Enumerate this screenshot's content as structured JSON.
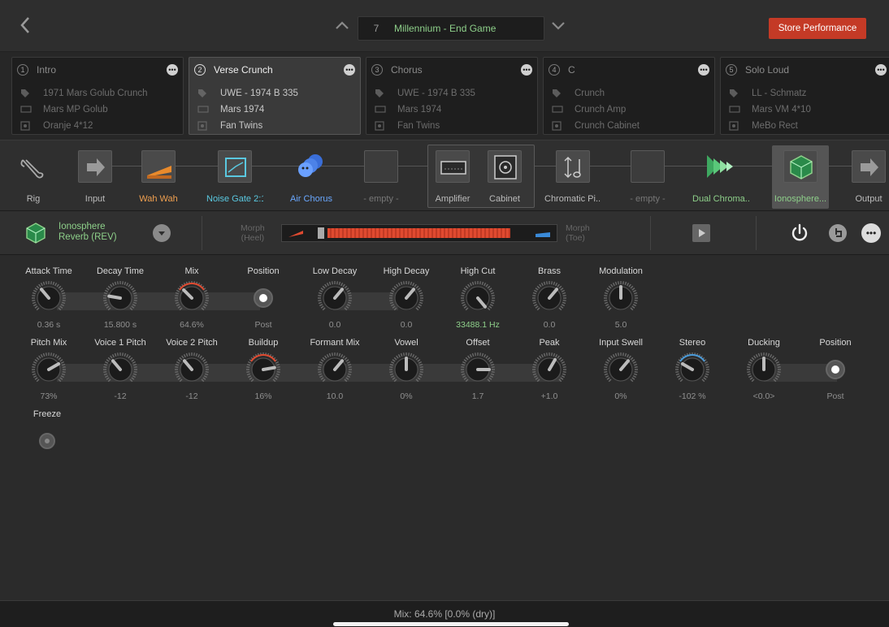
{
  "topbar": {
    "perf_number": "7",
    "perf_name": "Millennium - End Game",
    "store_label": "Store Performance"
  },
  "scenes": [
    {
      "num": "1",
      "name": "Intro",
      "pedal": "1971 Mars Golub Crunch",
      "amp": "Mars MP Golub",
      "cab": "Oranje 4*12",
      "active": false
    },
    {
      "num": "2",
      "name": "Verse Crunch",
      "pedal": "UWE - 1974 B 335",
      "amp": "Mars 1974",
      "cab": "Fan Twins",
      "active": true
    },
    {
      "num": "3",
      "name": "Chorus",
      "pedal": "UWE - 1974 B 335",
      "amp": "Mars 1974",
      "cab": "Fan Twins",
      "active": false
    },
    {
      "num": "4",
      "name": "C",
      "pedal": "Crunch",
      "amp": "Crunch Amp",
      "cab": "Crunch Cabinet",
      "active": false
    },
    {
      "num": "5",
      "name": "Solo Loud",
      "pedal": "LL - Schmatz",
      "amp": "Mars VM 4*10",
      "cab": "MeBo Rect",
      "active": false
    }
  ],
  "chain": [
    {
      "label": "Rig",
      "icon": "rig-icon"
    },
    {
      "label": "Input",
      "icon": "input-arrow-icon"
    },
    {
      "label": "Wah Wah",
      "icon": "wah-pedal-icon"
    },
    {
      "label": "Noise Gate 2:1",
      "icon": "noise-gate-icon"
    },
    {
      "label": "Air Chorus",
      "icon": "chorus-icon"
    },
    {
      "label": "- empty -",
      "icon": "empty-slot-icon"
    },
    {
      "label": "Amplifier",
      "icon": "amplifier-icon"
    },
    {
      "label": "Cabinet",
      "icon": "cabinet-icon"
    },
    {
      "label": "Chromatic Pi...",
      "icon": "pitch-icon"
    },
    {
      "label": "- empty -",
      "icon": "empty-slot-icon"
    },
    {
      "label": "Dual Chroma...",
      "icon": "dual-chromatic-icon"
    },
    {
      "label": "Ionosphere...",
      "icon": "ionosphere-icon"
    },
    {
      "label": "Output",
      "icon": "output-arrow-icon"
    }
  ],
  "plugin": {
    "name_line1": "Ionosphere",
    "name_line2": "Reverb (REV)",
    "morph_heel_line1": "Morph",
    "morph_heel_line2": "(Heel)",
    "morph_toe_line1": "Morph",
    "morph_toe_line2": "(Toe)",
    "morph_level": 0.75
  },
  "params_row1": [
    {
      "label": "Attack Time",
      "value": "0.36 s"
    },
    {
      "label": "Decay Time",
      "value": "15.800 s"
    },
    {
      "label": "Mix",
      "value": "64.6%"
    },
    {
      "label": "Position",
      "value": "Post"
    },
    {
      "label": "Low Decay",
      "value": "0.0"
    },
    {
      "label": "High Decay",
      "value": "0.0"
    },
    {
      "label": "High Cut",
      "value": "33488.1 Hz"
    },
    {
      "label": "Brass",
      "value": "0.0"
    },
    {
      "label": "Modulation",
      "value": "5.0"
    }
  ],
  "params_row2": [
    {
      "label": "Pitch Mix",
      "value": "73%"
    },
    {
      "label": "Voice 1 Pitch",
      "value": "-12"
    },
    {
      "label": "Voice 2 Pitch",
      "value": "-12"
    },
    {
      "label": "Buildup",
      "value": "16%"
    },
    {
      "label": "Formant Mix",
      "value": "10.0"
    },
    {
      "label": "Vowel",
      "value": "0%"
    },
    {
      "label": "Offset",
      "value": "1.7"
    },
    {
      "label": "Peak",
      "value": "+1.0"
    },
    {
      "label": "Input Swell",
      "value": "0%"
    },
    {
      "label": "Stereo",
      "value": "-102 %"
    },
    {
      "label": "Ducking",
      "value": "<0.0>"
    },
    {
      "label": "Position",
      "value": "Post"
    }
  ],
  "params_row3": [
    {
      "label": "Freeze"
    }
  ],
  "status": {
    "text": "Mix: 64.6%   [0.0% (dry)]"
  },
  "colors": {
    "accent_green": "#8ed08a",
    "store_red": "#c43a26",
    "wah_orange": "#f0a050",
    "gate_cyan": "#5ac8e0",
    "chorus_blue": "#6aa8ff"
  }
}
